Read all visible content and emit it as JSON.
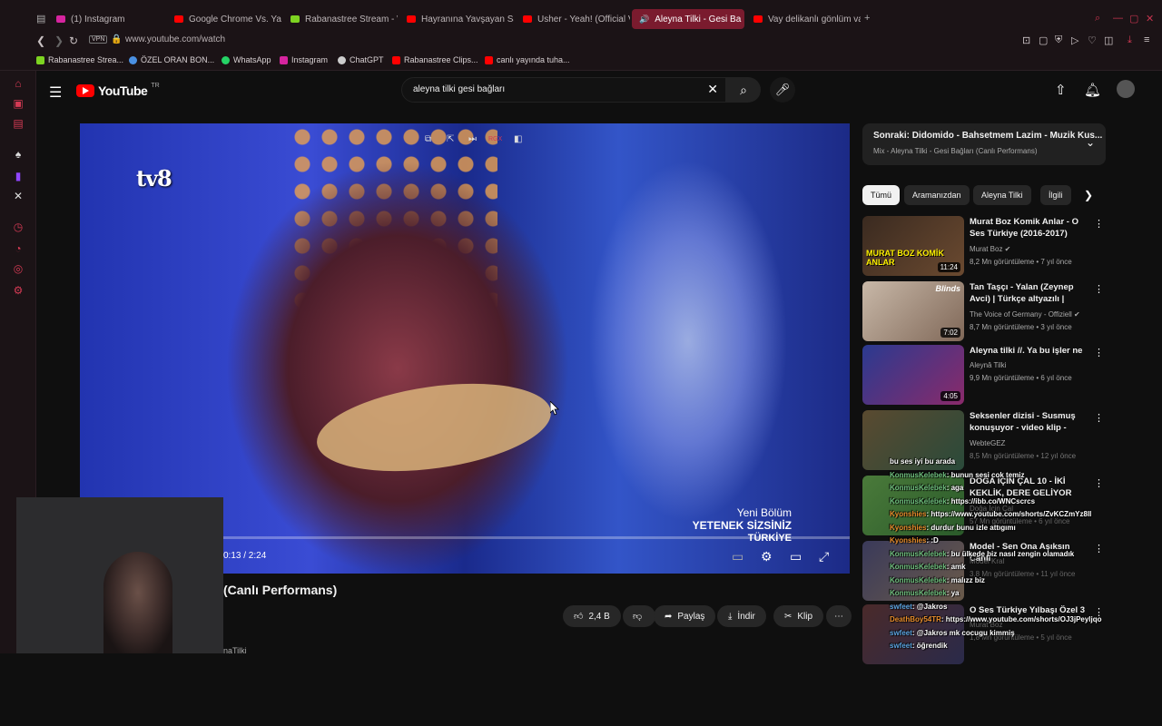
{
  "tabs": [
    {
      "label": "(1) Instagram",
      "color": "#d6249f"
    },
    {
      "label": "Google Chrome Vs. Yand",
      "color": "#ff0000"
    },
    {
      "label": "Rabanastree Stream - W",
      "color": "#7dd321"
    },
    {
      "label": "Hayranına Yavşayan Sab",
      "color": "#ff0000"
    },
    {
      "label": "Usher - Yeah! (Official Vi",
      "color": "#ff0000"
    },
    {
      "label": "Aleyna Tilki - Gesi Ba",
      "color": "#ff0000"
    },
    {
      "label": "Vay delikanlı gönlüm vay",
      "color": "#ff0000"
    }
  ],
  "address": {
    "vpn": "VPN",
    "url": "www.youtube.com/watch"
  },
  "bookmarks": [
    {
      "label": "Rabanastree Strea...",
      "color": "#7dd321"
    },
    {
      "label": "ÖZEL ORAN BON...",
      "color": "#4a90e2"
    },
    {
      "label": "WhatsApp",
      "color": "#25d366"
    },
    {
      "label": "Instagram",
      "color": "#d6249f"
    },
    {
      "label": "ChatGPT",
      "color": "#cccccc"
    },
    {
      "label": "Rabanastree Clips...",
      "color": "#ff0000"
    },
    {
      "label": "canlı yayında tuha...",
      "color": "#ff0000"
    }
  ],
  "youtube": {
    "logo": "YouTube",
    "country": "TR",
    "search_query": "aleyna tilki gesi bağları"
  },
  "player": {
    "channel_logo": "tv8",
    "overlay_line1": "Yeni Bölüm",
    "overlay_line2": "YETENEK SİZSİNİZ",
    "overlay_line3": "TÜRKİYE",
    "time": "0:13 / 2:24",
    "progress": 0.09,
    "mini_badge": "RGX"
  },
  "video": {
    "title": "(Canlı Performans)",
    "like_count": "2,4 B",
    "share": "Paylaş",
    "download": "İndir",
    "clip": "Klip",
    "channel": "naTilki"
  },
  "next": {
    "title": "Sonraki: Didomido - Bahsetmem Lazim - Muzik Kus...",
    "subtitle": "Mix - Aleyna Tilki - Gesi Bağları (Canlı Performans)"
  },
  "chips": [
    "Tümü",
    "Aramanızdan",
    "Aleyna Tilki",
    "İlgili"
  ],
  "recs": [
    {
      "title": "Murat Boz Komik Anlar - O Ses Türkiye (2016-2017)",
      "channel": "Murat Boz ✔",
      "meta": "8,2 Mn görüntüleme • 7 yıl önce",
      "duration": "11:24",
      "thumb_text": "MURAT BOZ KOMİK ANLAR"
    },
    {
      "title": "Tan Taşçı - Yalan (Zeynep Avci) | Türkçe altyazılı | Türkische ...",
      "channel": "The Voice of Germany - Offiziell ✔",
      "meta": "8,7 Mn görüntüleme • 3 yıl önce",
      "duration": "7:02",
      "thumb_text": "Blinds"
    },
    {
      "title": "Aleyna tilki //. Ya bu işler ne",
      "channel": "Aleynâ Tilki",
      "meta": "9,9 Mn görüntüleme • 6 yıl önce",
      "duration": "4:05",
      "thumb_text": ""
    },
    {
      "title": "Seksenler dizisi - Susmuş konuşuyor - video klip - Aydın ...",
      "channel": "WebteGEZ",
      "meta": "8,5 Mn görüntüleme • 12 yıl önce",
      "duration": "",
      "thumb_text": ""
    },
    {
      "title": "DOĞA İÇİN ÇAL 10 - İKİ KEKLİK, DERE GELİYOR DERE",
      "channel": "Doğa İçin Çal",
      "meta": "57 Mn görüntüleme • 6 yıl önce",
      "duration": "",
      "thumb_text": ""
    },
    {
      "title": "Model - Sen Ona Aşıksın Canlı",
      "channel": "Model Kral",
      "meta": "3,8 Mn görüntüleme • 11 yıl önce",
      "duration": "",
      "thumb_text": ""
    },
    {
      "title": "O Ses Türkiye Yılbaşı Özel 3",
      "channel": "Murat Boz",
      "meta": "1,8 Mn görüntüleme • 5 yıl önce",
      "duration": "",
      "thumb_text": ""
    }
  ],
  "chat": [
    {
      "user": "",
      "msg": "bu ses iyi bu arada"
    },
    {
      "user": "KonmusKelebek",
      "msg": ": bunun sesi cok temiz"
    },
    {
      "user": "KonmusKelebek",
      "msg": ": aga"
    },
    {
      "user": "KonmusKelebek",
      "msg": ": https://ibb.co/WNCscrcs"
    },
    {
      "user": "Kyonshies",
      "msg": ": https://www.youtube.com/shorts/ZvKCZmYz8ll"
    },
    {
      "user": "Kyonshies",
      "msg": ": durdur bunu izle attıgımı"
    },
    {
      "user": "Kyonshies",
      "msg": ": :D"
    },
    {
      "user": "KonmusKelebek",
      "msg": ": bu ülkede biz nasıl zengin olamadık"
    },
    {
      "user": "KonmusKelebek",
      "msg": ": amk"
    },
    {
      "user": "KonmusKelebek",
      "msg": ": malızz biz"
    },
    {
      "user": "KonmusKelebek",
      "msg": ": ya"
    },
    {
      "user": "swfeet",
      "msg": ": @Jakros"
    },
    {
      "user": "DeathBoy54TR",
      "msg": ": https://www.youtube.com/shorts/OJ3jPeyljqo"
    },
    {
      "user": "swfeet",
      "msg": ": @Jakros mk cocugu kimmiş"
    },
    {
      "user": "swfeet",
      "msg": ": öğrendik"
    }
  ]
}
